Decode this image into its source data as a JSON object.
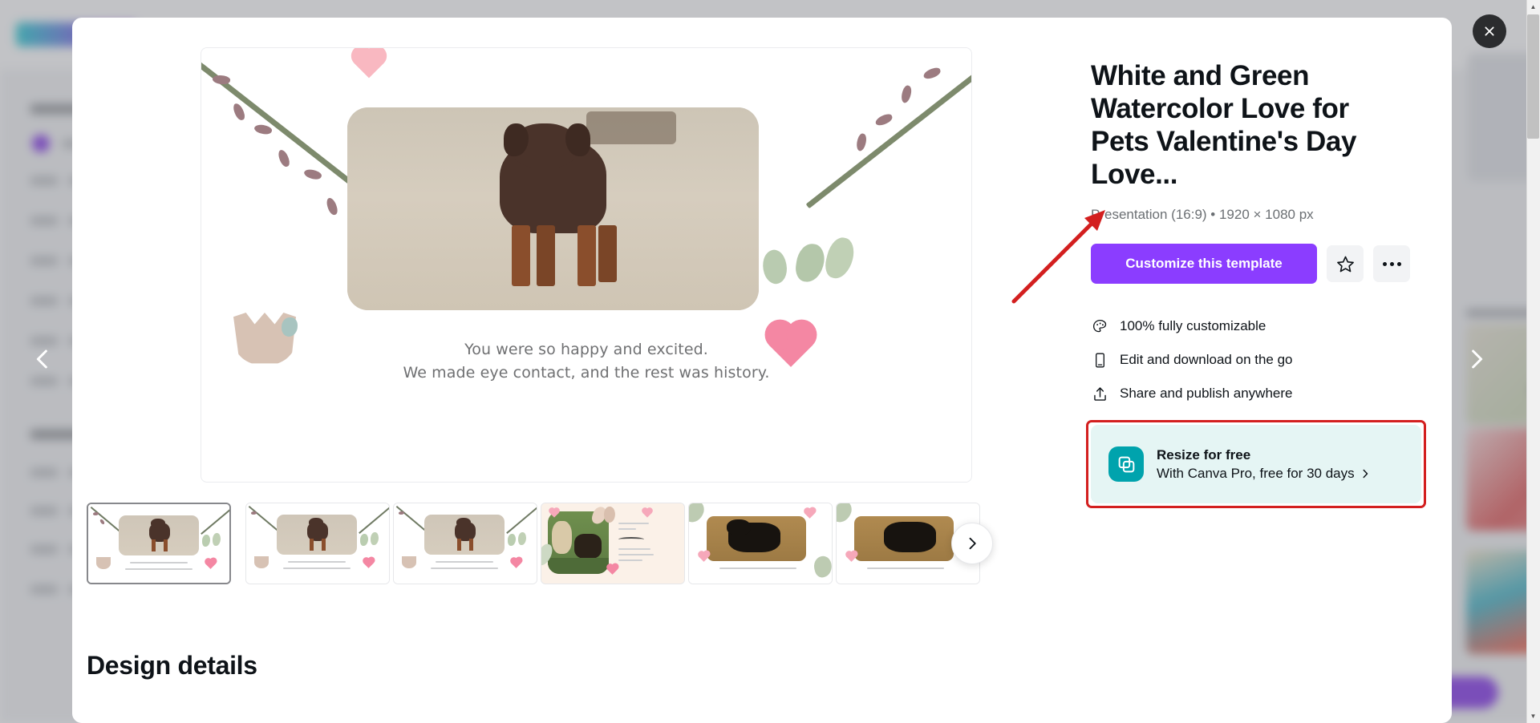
{
  "window": {
    "close_label": "×"
  },
  "nav": {
    "prev_label": "‹",
    "next_label": "›"
  },
  "preview": {
    "caption_line1": "You were so happy and excited.",
    "caption_line2": "We made eye contact, and the rest was history."
  },
  "thumbnails": {
    "next_label": "›",
    "items": [
      {
        "name": "slide-1",
        "selected": true,
        "caption": "You were so happy and excited."
      },
      {
        "name": "slide-2",
        "selected": false,
        "caption": "You were so happy and excited."
      },
      {
        "name": "slide-3",
        "selected": false,
        "caption": "You were so happy and excited."
      },
      {
        "name": "slide-4",
        "selected": false,
        "caption": "Then back at the park one more time."
      },
      {
        "name": "slide-5",
        "selected": false,
        "caption": "As soon as I lay in a different spot, he felt right at home in the grass."
      },
      {
        "name": "slide-6",
        "selected": false,
        "caption": "As soon as I lay in a"
      }
    ]
  },
  "sections": {
    "design_details_heading": "Design details"
  },
  "details": {
    "title": "White and Green Watercolor Love for Pets Valentine's Day Love...",
    "meta": "Presentation (16:9) • 1920 × 1080 px",
    "customize_label": "Customize this template",
    "star_label": "Add to favorites",
    "more_label": "More options",
    "features": [
      {
        "icon": "palette-icon",
        "label": "100% fully customizable"
      },
      {
        "icon": "mobile-icon",
        "label": "Edit and download on the go"
      },
      {
        "icon": "share-icon",
        "label": "Share and publish anywhere"
      }
    ],
    "resize": {
      "title": "Resize for free",
      "subtitle": "With Canva Pro, free for 30 days",
      "chevron": "›"
    }
  },
  "colors": {
    "brand_purple": "#8b3dff",
    "teal": "#00a3ad",
    "banner_bg": "#e5f5f4",
    "annotation_red": "#d31f1f",
    "text_primary": "#0e1318",
    "text_muted": "#6b6f73"
  }
}
